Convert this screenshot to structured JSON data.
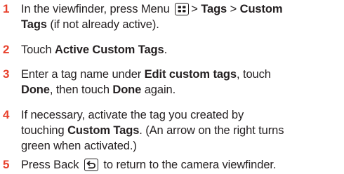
{
  "steps": [
    {
      "number": "1",
      "line1_a": "In the viewfinder, press Menu",
      "line1_b": "> ",
      "line1_bold1": "Tags",
      "line1_c": " > ",
      "line1_bold2": "Custom",
      "line2_bold": "Tags",
      "line2_rest": " (if not already active).",
      "icon": "menu-grid-icon"
    },
    {
      "number": "2",
      "pre": "Touch ",
      "bold": "Active Custom Tags",
      "post": "."
    },
    {
      "number": "3",
      "pre": "Enter a tag name under ",
      "bold1": "Edit custom tags",
      "mid": ", touch",
      "bold2": "Done",
      "mid2": ", then touch ",
      "bold3": "Done",
      "post": " again."
    },
    {
      "number": "4",
      "line1": "If necessary, activate the tag you created by",
      "pre2": "touching ",
      "bold": "Custom Tags",
      "post2": ". (An arrow on the right turns",
      "line3": "green when activated.)"
    },
    {
      "number": "5",
      "pre": "Press Back",
      "post": "to return to the camera viewfinder.",
      "icon": "back-arrow-icon"
    }
  ],
  "colors": {
    "number": "#e8402b",
    "text": "#231f20"
  }
}
